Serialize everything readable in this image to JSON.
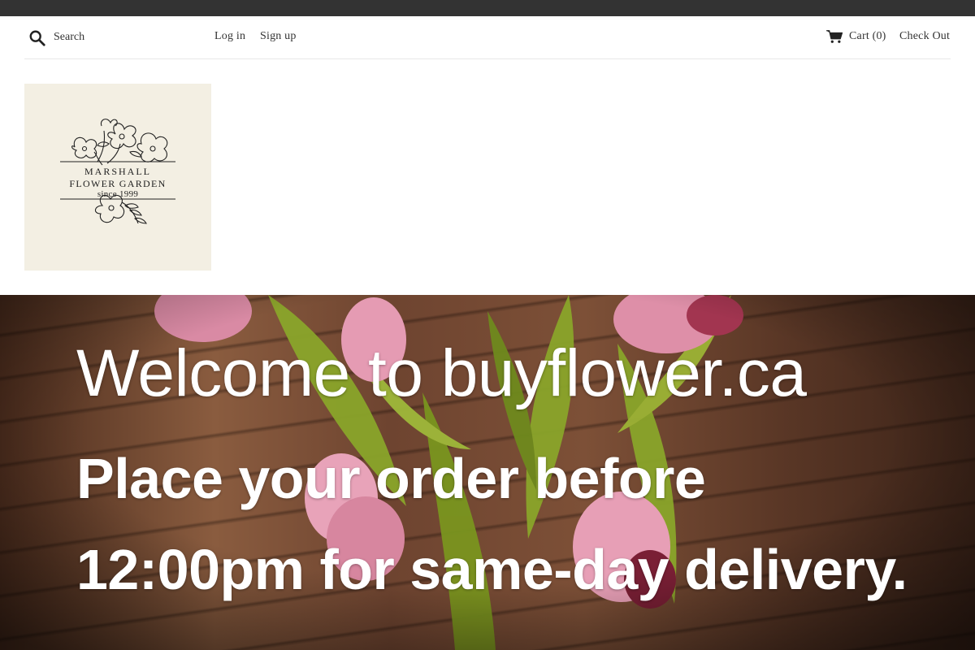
{
  "colors": {
    "topbar": "#333333",
    "text": "#333333",
    "logo_bg": "#f3efe3",
    "hero_text": "#ffffff"
  },
  "header": {
    "search_icon": "search-icon",
    "search_placeholder": "Search",
    "login_label": "Log in",
    "signup_label": "Sign up",
    "cart_icon": "cart-icon",
    "cart_label": "Cart (0)",
    "checkout_label": "Check Out"
  },
  "logo": {
    "line1": "MARSHALL",
    "line2": "FLOWER GARDEN",
    "line3": "since 1999"
  },
  "hero": {
    "title": "Welcome to buyflower.ca",
    "subtitle": "Place your order before 12:00pm for same-day delivery."
  }
}
